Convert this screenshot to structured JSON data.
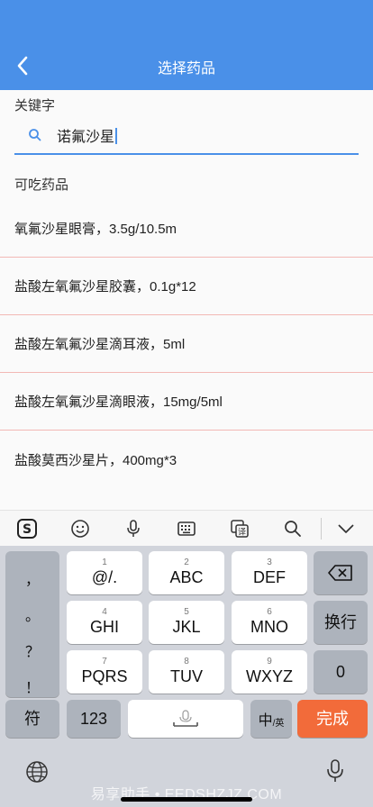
{
  "header": {
    "title": "选择药品",
    "back_icon": "chevron-left-icon"
  },
  "search": {
    "label": "关键字",
    "value": "诺氟沙星"
  },
  "drugs": {
    "section_label": "可吃药品",
    "items": [
      "氧氟沙星眼膏，3.5g/10.5m",
      "盐酸左氧氟沙星胶囊，0.1g*12",
      "盐酸左氧氟沙星滴耳液，5ml",
      "盐酸左氧氟沙星滴眼液，15mg/5ml",
      "盐酸莫西沙星片，400mg*3"
    ]
  },
  "keyboard": {
    "punct": [
      "，",
      "。",
      "？",
      "！"
    ],
    "keys": [
      {
        "num": "1",
        "letters": "@/."
      },
      {
        "num": "2",
        "letters": "ABC"
      },
      {
        "num": "3",
        "letters": "DEF"
      },
      {
        "num": "4",
        "letters": "GHI"
      },
      {
        "num": "5",
        "letters": "JKL"
      },
      {
        "num": "6",
        "letters": "MNO"
      },
      {
        "num": "7",
        "letters": "PQRS"
      },
      {
        "num": "8",
        "letters": "TUV"
      },
      {
        "num": "9",
        "letters": "WXYZ"
      }
    ],
    "newline": "换行",
    "zero": "0",
    "symbol": "符",
    "num123": "123",
    "lang_main": "中",
    "lang_sub": "/英",
    "done": "完成",
    "accent_color": "#f26b3a"
  },
  "watermark": "易享助手 • EEDSHZJZ.COM",
  "colors": {
    "header": "#4a90e8",
    "divider": "#f2b8b5"
  }
}
